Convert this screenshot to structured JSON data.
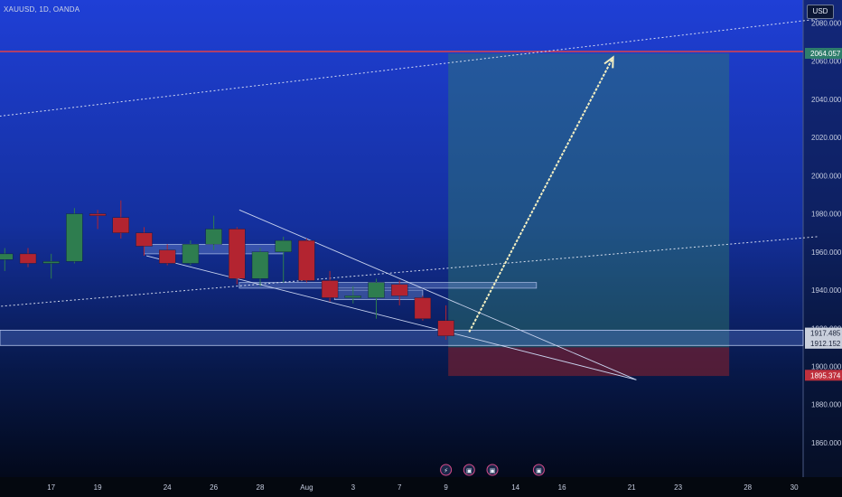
{
  "header": {
    "symbol": "XAUUSD, 1D, OANDA",
    "currency": "USD"
  },
  "colors": {
    "up": "#2e7d4f",
    "down": "#b32430",
    "resistance": "#e0404a",
    "target": "#2e7d6b",
    "stop": "#6b1f33",
    "arrow": "#f3efc2"
  },
  "chart_data": {
    "type": "candlestick",
    "ylim": [
      1842,
      2092
    ],
    "y_ticks": [
      {
        "v": 2080,
        "label": "2080.000"
      },
      {
        "v": 2060,
        "label": "2060.000"
      },
      {
        "v": 2040,
        "label": "2040.000"
      },
      {
        "v": 2020,
        "label": "2020.000"
      },
      {
        "v": 2000,
        "label": "2000.000"
      },
      {
        "v": 1980,
        "label": "1980.000"
      },
      {
        "v": 1960,
        "label": "1960.000"
      },
      {
        "v": 1940,
        "label": "1940.000"
      },
      {
        "v": 1920,
        "label": "1920.000"
      },
      {
        "v": 1900,
        "label": "1900.000"
      },
      {
        "v": 1880,
        "label": "1880.000"
      },
      {
        "v": 1860,
        "label": "1860.000"
      }
    ],
    "x_ticks": [
      {
        "i": 1,
        "label": "17"
      },
      {
        "i": 3,
        "label": "19"
      },
      {
        "i": 6,
        "label": "24"
      },
      {
        "i": 8,
        "label": "26"
      },
      {
        "i": 10,
        "label": "28"
      },
      {
        "i": 12,
        "label": "Aug"
      },
      {
        "i": 14,
        "label": "3"
      },
      {
        "i": 16,
        "label": "7"
      },
      {
        "i": 18,
        "label": "9"
      },
      {
        "i": 21,
        "label": "14"
      },
      {
        "i": 23,
        "label": "16"
      },
      {
        "i": 26,
        "label": "21"
      },
      {
        "i": 28,
        "label": "23"
      },
      {
        "i": 31,
        "label": "28"
      },
      {
        "i": 33,
        "label": "30"
      }
    ],
    "candles": [
      {
        "i": -1,
        "o": 1956,
        "h": 1962,
        "l": 1950,
        "c": 1959
      },
      {
        "i": 0,
        "o": 1959,
        "h": 1962,
        "l": 1952,
        "c": 1954
      },
      {
        "i": 1,
        "o": 1954,
        "h": 1959,
        "l": 1946,
        "c": 1955
      },
      {
        "i": 2,
        "o": 1955,
        "h": 1983,
        "l": 1954,
        "c": 1980
      },
      {
        "i": 3,
        "o": 1980,
        "h": 1982,
        "l": 1972,
        "c": 1979
      },
      {
        "i": 4,
        "o": 1978,
        "h": 1987,
        "l": 1967,
        "c": 1970
      },
      {
        "i": 5,
        "o": 1970,
        "h": 1973,
        "l": 1958,
        "c": 1963
      },
      {
        "i": 6,
        "o": 1961,
        "h": 1964,
        "l": 1953,
        "c": 1954
      },
      {
        "i": 7,
        "o": 1954,
        "h": 1966,
        "l": 1953,
        "c": 1964
      },
      {
        "i": 8,
        "o": 1964,
        "h": 1979,
        "l": 1961,
        "c": 1972
      },
      {
        "i": 9,
        "o": 1972,
        "h": 1973,
        "l": 1943,
        "c": 1946
      },
      {
        "i": 10,
        "o": 1946,
        "h": 1962,
        "l": 1942,
        "c": 1960
      },
      {
        "i": 11,
        "o": 1960,
        "h": 1968,
        "l": 1944,
        "c": 1966
      },
      {
        "i": 12,
        "o": 1966,
        "h": 1967,
        "l": 1944,
        "c": 1945
      },
      {
        "i": 13,
        "o": 1945,
        "h": 1950,
        "l": 1934,
        "c": 1936
      },
      {
        "i": 14,
        "o": 1936,
        "h": 1942,
        "l": 1933,
        "c": 1937
      },
      {
        "i": 15,
        "o": 1936,
        "h": 1946,
        "l": 1925,
        "c": 1944
      },
      {
        "i": 16,
        "o": 1943,
        "h": 1945,
        "l": 1932,
        "c": 1937
      },
      {
        "i": 17,
        "o": 1936,
        "h": 1937,
        "l": 1924,
        "c": 1925
      },
      {
        "i": 18,
        "o": 1924,
        "h": 1932,
        "l": 1914,
        "c": 1916
      }
    ],
    "resistance": {
      "v": 2065
    },
    "target_zone": {
      "i0": 18.1,
      "i1": 30.2,
      "top": 2064,
      "bottom": 1910
    },
    "stop_zone": {
      "i0": 18.1,
      "i1": 30.2,
      "top": 1910,
      "bottom": 1895
    },
    "support_zone": {
      "top": 1919,
      "bottom": 1911
    },
    "channel_lines": [
      {
        "i0": -20,
        "v0": 2004,
        "i1": 34,
        "v1": 2082
      },
      {
        "i0": -20,
        "v0": 1912,
        "i1": 34,
        "v1": 1968
      }
    ],
    "wedge_lines": [
      {
        "i0": 9.1,
        "v0": 1982,
        "i1": 26.2,
        "v1": 1893
      },
      {
        "i0": 5.1,
        "v0": 1958,
        "i1": 26.2,
        "v1": 1893
      }
    ],
    "small_zones": [
      {
        "i0": 5.0,
        "i1": 11.0,
        "top": 1964,
        "bottom": 1959
      },
      {
        "i0": 9.1,
        "i1": 21.9,
        "top": 1944,
        "bottom": 1941
      },
      {
        "i0": 13.2,
        "i1": 17.0,
        "top": 1940,
        "bottom": 1935
      }
    ],
    "arrow": {
      "i0": 19.0,
      "v0": 1918,
      "i1": 25.2,
      "v1": 2062
    },
    "price_labels": [
      {
        "v": 2064.057,
        "label": "2064.057",
        "bg": "#2e7d6b",
        "fg": "#ffffff"
      },
      {
        "v": 1917.485,
        "label": "1917.485",
        "bg": "#c9cfdc",
        "fg": "#1a2238"
      },
      {
        "v": 1912.152,
        "label": "1912.152",
        "bg": "#c9cfdc",
        "fg": "#1a2238"
      },
      {
        "v": 1895.374,
        "label": "1895.374",
        "bg": "#c0303d",
        "fg": "#ffffff"
      }
    ],
    "event_markers": [
      {
        "i": 18,
        "glyph": "⚡"
      },
      {
        "i": 19,
        "glyph": "▣"
      },
      {
        "i": 20,
        "glyph": "▣"
      },
      {
        "i": 22,
        "glyph": "▣"
      }
    ]
  }
}
